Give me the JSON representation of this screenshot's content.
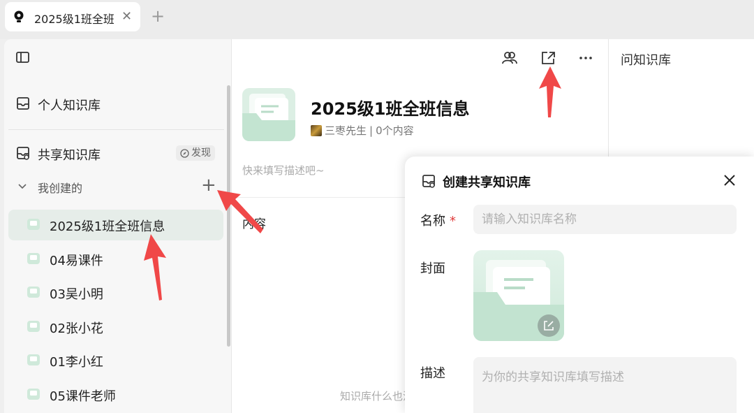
{
  "tab": {
    "title": "2025级1班全班信息",
    "new_tab": "+",
    "close": "✕"
  },
  "sidebar": {
    "personal": "个人知识库",
    "shared": "共享知识库",
    "discover": "发现",
    "mine": "我创建的",
    "add": "+",
    "items": [
      {
        "label": "2025级1班全班信息",
        "active": true
      },
      {
        "label": "04易课件"
      },
      {
        "label": "03吴小明"
      },
      {
        "label": "02张小花"
      },
      {
        "label": "01李小红"
      },
      {
        "label": "05课件老师"
      }
    ]
  },
  "main": {
    "title": "2025级1班全班信息",
    "author": "三枣先生",
    "separator": "|",
    "count": "0个内容",
    "description_placeholder": "快来填写描述吧~",
    "content_heading": "内容",
    "empty_text": "知识库什么也没有"
  },
  "right": {
    "ask": "问知识库"
  },
  "dialog": {
    "title": "创建共享知识库",
    "name_label": "名称",
    "required_mark": "*",
    "name_placeholder": "请输入知识库名称",
    "cover_label": "封面",
    "desc_label": "描述",
    "desc_placeholder": "为你的共享知识库填写描述"
  },
  "colors": {
    "accent_green": "#7fc4a0",
    "arrow_red": "#f04848",
    "active_item": "#e6ede9"
  }
}
